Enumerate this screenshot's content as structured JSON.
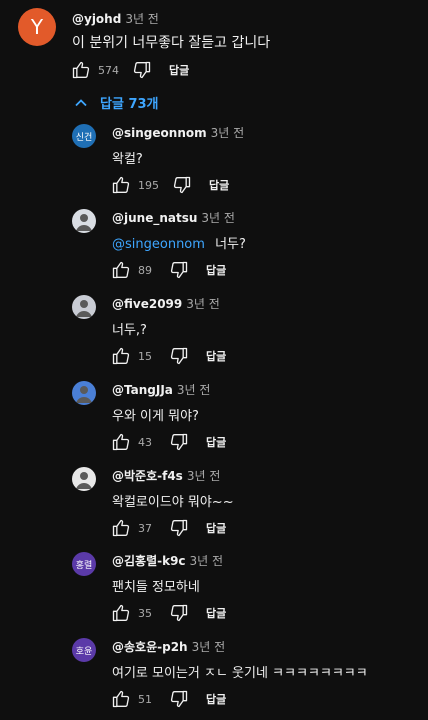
{
  "main_comment": {
    "avatar_letter": "Y",
    "avatar_color": "#e25a2a",
    "author": "@yjohd",
    "time": "3년 전",
    "text": "이 분위기 너무좋다 잘듣고 갑니다",
    "likes": "574",
    "reply_label": "답글"
  },
  "replies_toggle": {
    "label": "답글 73개",
    "icon": "chevron-up-icon"
  },
  "replies": [
    {
      "author": "@singeonnom",
      "time": "3년 전",
      "text": "왁컬?",
      "likes": "195",
      "reply_label": "답글",
      "avatar_text": "신건",
      "avatar_color": "#1f6fb5"
    },
    {
      "author": "@june_natsu",
      "time": "3년 전",
      "mention": "@singeonnom",
      "text": "너두?",
      "likes": "89",
      "reply_label": "답글",
      "avatar_text": "",
      "avatar_color": "#d9dde3"
    },
    {
      "author": "@five2099",
      "time": "3년 전",
      "text": "너두,?",
      "likes": "15",
      "reply_label": "답글",
      "avatar_text": "",
      "avatar_color": "#c9ccd4"
    },
    {
      "author": "@TangJJa",
      "time": "3년 전",
      "text": "우와 이게 뭐야?",
      "likes": "43",
      "reply_label": "답글",
      "avatar_text": "",
      "avatar_color": "#4a7fd6"
    },
    {
      "author": "@박준호-f4s",
      "time": "3년 전",
      "text": "왁컬로이드야 뭐야~~",
      "likes": "37",
      "reply_label": "답글",
      "avatar_text": "",
      "avatar_color": "#e8e8e8"
    },
    {
      "author": "@김홍렬-k9c",
      "time": "3년 전",
      "text": "팬치들 정모하네",
      "likes": "35",
      "reply_label": "답글",
      "avatar_text": "홍렬",
      "avatar_color": "#5b3aa8"
    },
    {
      "author": "@송호윤-p2h",
      "time": "3년 전",
      "text": "여기로 모이는거 ㅈㄴ 웃기네 ㅋㅋㅋㅋㅋㅋㅋㅋ",
      "likes": "51",
      "reply_label": "답글",
      "avatar_text": "호윤",
      "avatar_color": "#5b3aa8"
    }
  ]
}
